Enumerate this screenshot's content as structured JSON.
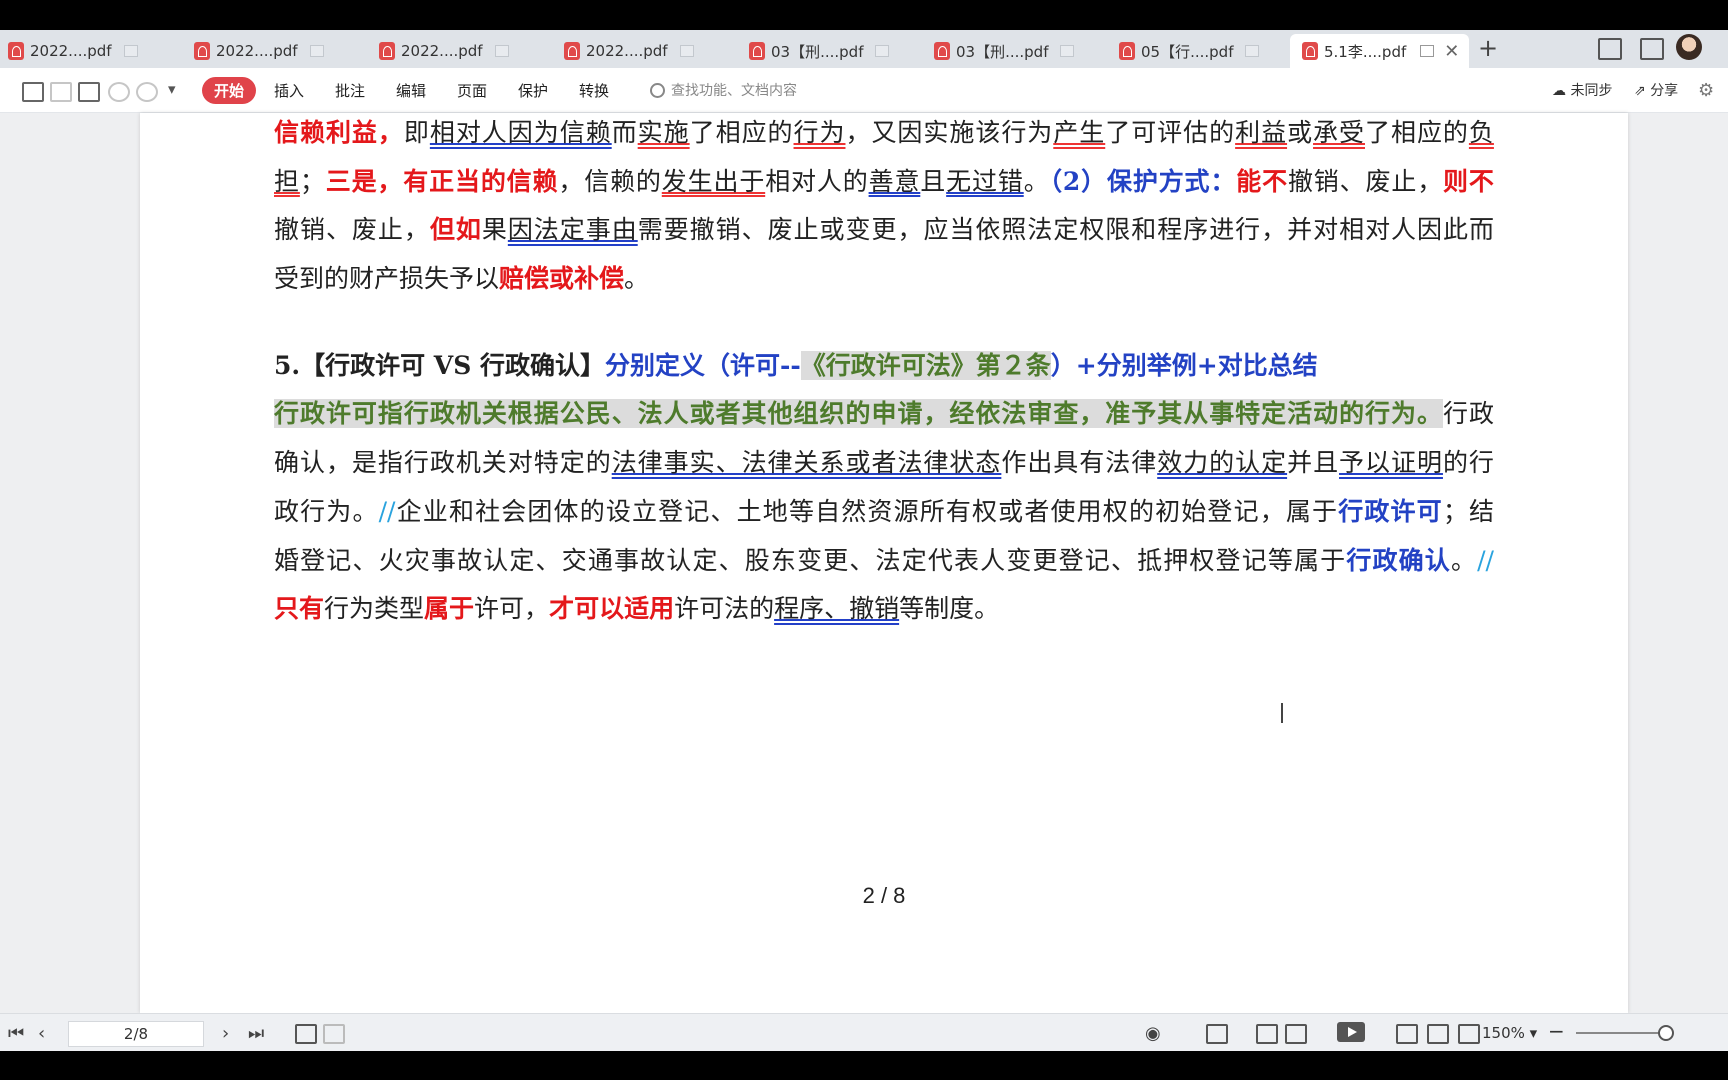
{
  "tabs": [
    {
      "label": "2022....pdf"
    },
    {
      "label": "2022....pdf"
    },
    {
      "label": "2022....pdf"
    },
    {
      "label": "2022....pdf"
    },
    {
      "label": "03【刑....pdf"
    },
    {
      "label": "03【刑....pdf"
    },
    {
      "label": "05【行....pdf"
    },
    {
      "label": "5.1李....pdf"
    }
  ],
  "toolbar": {
    "start": "开始",
    "insert": "插入",
    "comment": "批注",
    "edit": "编辑",
    "page": "页面",
    "protect": "保护",
    "convert": "转换",
    "search_placeholder": "查找功能、文档内容",
    "sync": "未同步",
    "share": "分享"
  },
  "doc": {
    "l1": [
      "信赖利益，",
      "即",
      "相对人因为信赖",
      "而",
      "实施",
      "了相应的",
      "行为",
      "，又因实施该行为",
      "产生",
      "了可评估的",
      "利益",
      "或",
      "承受",
      "了相应的",
      "负"
    ],
    "l2": [
      "担",
      "；",
      "三是，有正当的信赖",
      "，信赖的",
      "发生出于",
      "相对人的",
      "善意",
      "且",
      "无过错",
      "。",
      "（2）保护方式：",
      "能不",
      "撤销、废止，",
      "则不"
    ],
    "l3": [
      "撤销、废止，",
      "但如",
      "果",
      "因法定事由",
      "需要撤销、废止或变更，应当依照法定权限和程序进行，并对相对人因此而"
    ],
    "l4": [
      "受到的财产损失予以",
      "赔偿或补偿",
      "。"
    ],
    "h1": [
      "5.【行政许可 VS 行政确认】",
      "分别定义（许可--",
      "《行政许可法》第２条",
      "）+分别举例+对比总结"
    ],
    "p1": [
      "行政许可指行政机关根据公民、法人或者其他组织的申请，经依法审查，准予其从事特定活动的行为。",
      "行政"
    ],
    "p2": [
      "确认，是指行政机关对特定的",
      "法律事实、法律关系或者法律状态",
      "作出具有法律",
      "效力的认定",
      "并且",
      "予以证明",
      "的行"
    ],
    "p3": [
      "政行为。",
      "//",
      "企业和社会团体的设立登记、土地等自然资源所有权或者使用权的初始登记，属于",
      "行政许可",
      "；结"
    ],
    "p4": [
      "婚登记、火灾事故认定、交通事故认定、股东变更、法定代表人变更登记、抵押权登记等属于",
      "行政确认",
      "。",
      "//"
    ],
    "p5": [
      "只有",
      "行为类型",
      "属于",
      "许可，",
      "才可以适用",
      "许可法的",
      "程序、撤销",
      "等制度。"
    ],
    "page_number": "2 / 8"
  },
  "status": {
    "page_input": "2/8",
    "zoom": "150%"
  }
}
